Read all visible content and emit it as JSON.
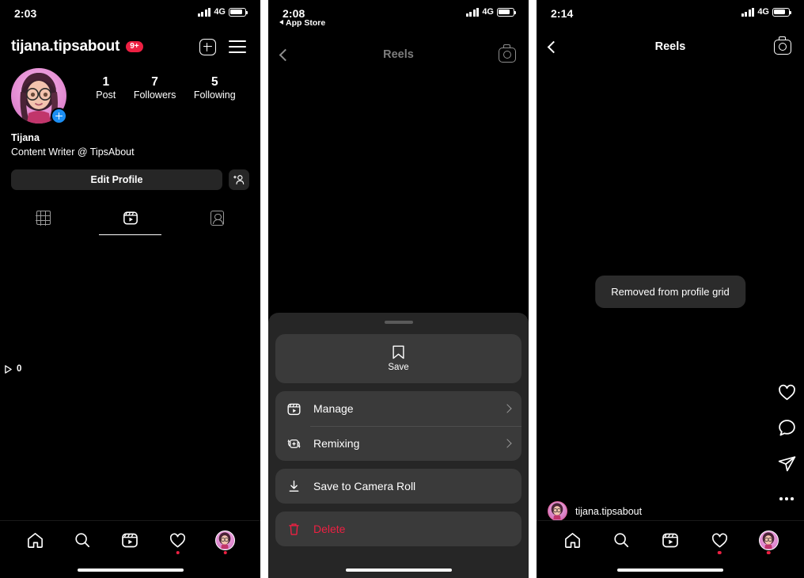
{
  "panel1": {
    "status": {
      "time": "2:03",
      "network": "4G"
    },
    "header": {
      "username": "tijana.tipsabout",
      "badge": "9+",
      "new_post_icon": "plus-square-icon",
      "menu_icon": "hamburger-icon"
    },
    "stats": [
      {
        "number": "1",
        "label": "Post"
      },
      {
        "number": "7",
        "label": "Followers"
      },
      {
        "number": "5",
        "label": "Following"
      }
    ],
    "bio": {
      "name": "Tijana",
      "description": "Content Writer @ TipsAbout"
    },
    "buttons": {
      "edit_profile": "Edit Profile",
      "add_person_icon": "add-person-icon"
    },
    "tabs": [
      {
        "name": "grid",
        "icon": "grid-icon",
        "active": false
      },
      {
        "name": "reels",
        "icon": "reels-icon",
        "active": true
      },
      {
        "name": "tagged",
        "icon": "tagged-icon",
        "active": false
      }
    ],
    "play_count": "0"
  },
  "panel2": {
    "status": {
      "time": "2:08",
      "network": "4G",
      "return_app": "App Store"
    },
    "header": {
      "title": "Reels",
      "back_icon": "chevron-left-icon",
      "camera_icon": "camera-icon"
    },
    "sheet": {
      "save": {
        "label": "Save",
        "icon": "bookmark-icon"
      },
      "items": [
        {
          "label": "Manage",
          "icon": "reels-icon",
          "chevron": true,
          "danger": false
        },
        {
          "label": "Remixing",
          "icon": "remix-icon",
          "chevron": true,
          "danger": false
        },
        {
          "label": "Save to Camera Roll",
          "icon": "download-icon",
          "chevron": false,
          "danger": false
        },
        {
          "label": "Delete",
          "icon": "trash-icon",
          "chevron": false,
          "danger": true
        }
      ]
    }
  },
  "panel3": {
    "status": {
      "time": "2:14",
      "network": "4G"
    },
    "header": {
      "title": "Reels",
      "back_icon": "chevron-left-icon",
      "camera_icon": "camera-icon"
    },
    "toast": "Removed from profile grid",
    "rail": [
      {
        "name": "like",
        "icon": "heart-icon"
      },
      {
        "name": "comment",
        "icon": "comment-icon"
      },
      {
        "name": "share",
        "icon": "paper-plane-icon"
      },
      {
        "name": "more",
        "icon": "ellipsis-icon"
      }
    ],
    "author": {
      "username": "tijana.tipsabout"
    }
  },
  "bottom_nav": [
    {
      "name": "home",
      "icon": "home-icon",
      "dot": false
    },
    {
      "name": "search",
      "icon": "search-icon",
      "dot": false
    },
    {
      "name": "reels",
      "icon": "reels-icon",
      "dot": false
    },
    {
      "name": "activity",
      "icon": "heart-icon",
      "dot": true
    },
    {
      "name": "profile",
      "icon": "avatar-icon",
      "dot": true
    }
  ],
  "colors": {
    "accent_red": "#ed2042",
    "blue": "#1c8ef3",
    "sheet_bg": "#262626",
    "card_bg": "#3a3a3a"
  }
}
